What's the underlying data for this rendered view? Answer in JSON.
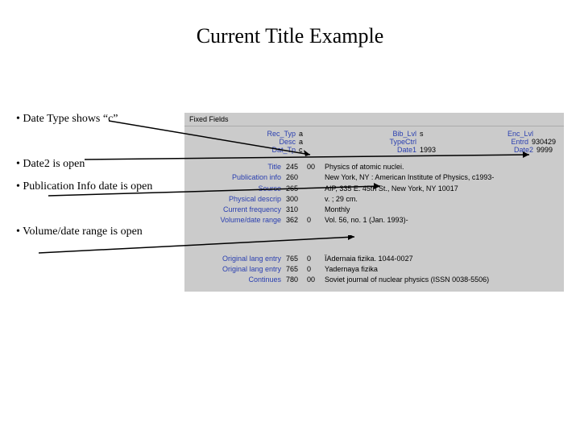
{
  "title": "Current Title Example",
  "bullets": {
    "b1": "• Date Type shows “c”",
    "b2": "• Date2 is open",
    "b3": "• Publication Info date is open",
    "b4": "• Volume/date range is open"
  },
  "panel": {
    "header": "Fixed Fields",
    "ff": {
      "r1": {
        "l1": "Rec_Typ",
        "v1": "a",
        "l2": "Bib_Lvl",
        "v2": "s",
        "l3": "Enc_Lvl",
        "v3": ""
      },
      "r2": {
        "l1": "Desc",
        "v1": "a",
        "l2": "TypeCtrl",
        "v2": "",
        "l3": "Entrd",
        "v3": "930429"
      },
      "r3": {
        "l1": "Dat_Tp",
        "v1": "c",
        "l2": "Date1",
        "v2": "1993",
        "l3": "Date2",
        "v3": "9999"
      }
    },
    "rows": [
      {
        "label": "Title",
        "tag": "245",
        "ind": "00",
        "val": "Physics of atomic nuclei."
      },
      {
        "label": "Publication info",
        "tag": "260",
        "ind": "",
        "val": "New York, NY : American Institute of Physics, c1993-"
      },
      {
        "label": "Source",
        "tag": "265",
        "ind": "",
        "val": "AIP, 335 E. 45th St., New York, NY 10017"
      },
      {
        "label": "Physical descrip",
        "tag": "300",
        "ind": "",
        "val": "v. ; 29 cm."
      },
      {
        "label": "Current frequency",
        "tag": "310",
        "ind": "",
        "val": "Monthly"
      },
      {
        "label": "Volume/date range",
        "tag": "362",
        "ind": "0",
        "val": "Vol. 56, no. 1 (Jan. 1993)-"
      }
    ],
    "rows2": [
      {
        "label": "Original lang entry",
        "tag": "765",
        "ind": "0",
        "val": "ÏAdernaia fizika. 1044-0027"
      },
      {
        "label": "Original lang entry",
        "tag": "765",
        "ind": "0",
        "val": "Yadernaya fizika"
      },
      {
        "label": "Continues",
        "tag": "780",
        "ind": "00",
        "val": "Soviet journal of nuclear physics (ISSN 0038-5506)"
      }
    ]
  }
}
